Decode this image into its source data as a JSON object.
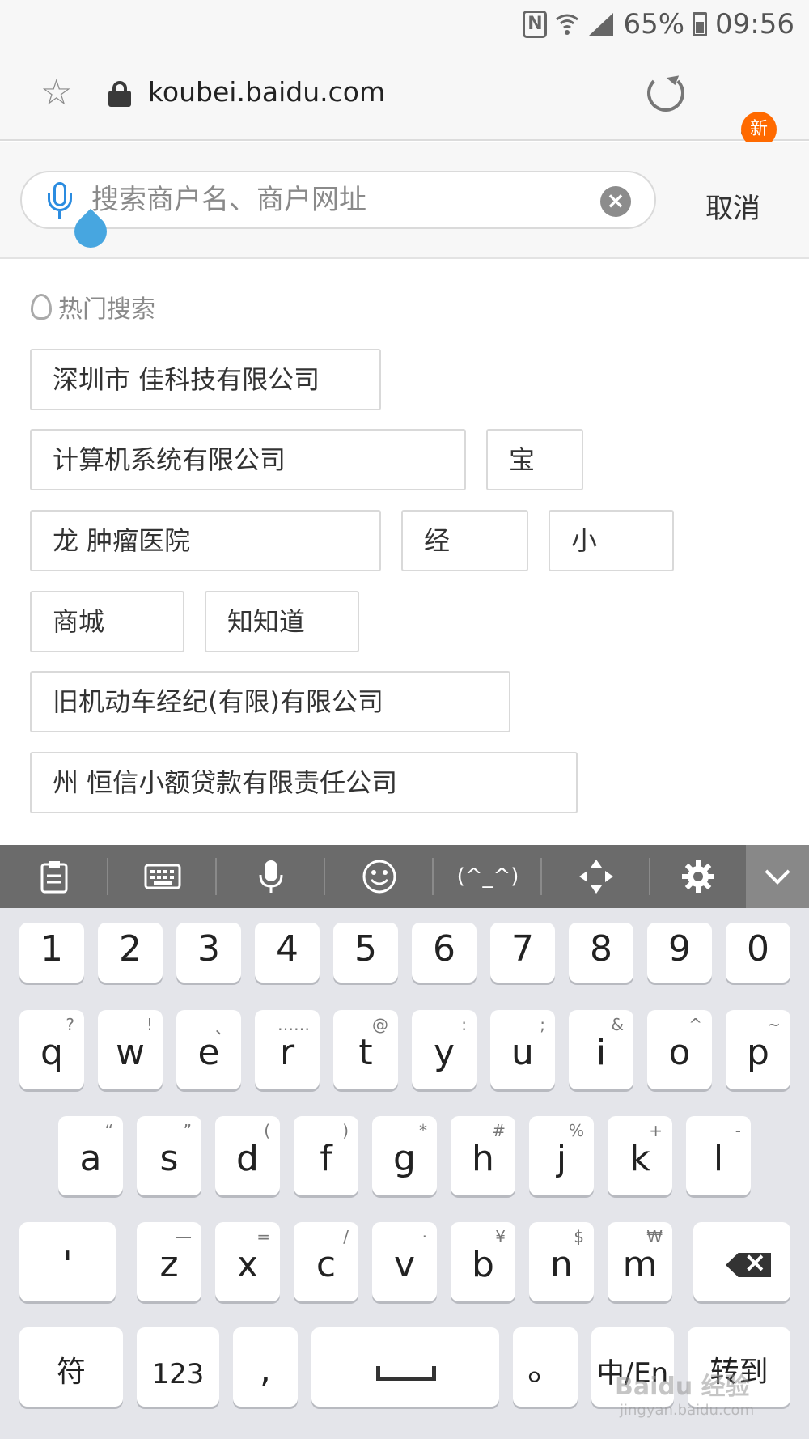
{
  "status_bar": {
    "battery": "65%",
    "time": "09:56",
    "nfc": "N",
    "icons": [
      "nfc-icon",
      "wifi-icon",
      "signal-icon",
      "battery-icon"
    ]
  },
  "browser": {
    "url": "koubei.baidu.com",
    "menu_badge": "新",
    "icons": [
      "star-icon",
      "lock-icon",
      "reload-icon",
      "menu-icon"
    ]
  },
  "search": {
    "placeholder": "搜索商户名、商户网址",
    "cancel_label": "取消",
    "icons": [
      "mic-icon",
      "clear-icon"
    ]
  },
  "hot": {
    "title": "热门搜索",
    "items": [
      "深圳市 佳科技有限公司",
      "计算机系统有限公司",
      "宝",
      "龙 肿瘤医院",
      "经",
      "小",
      "商城",
      "知知道",
      "旧机动车经纪(有限)有限公司",
      "州 恒信小额贷款有限责任公司"
    ]
  },
  "keyboard": {
    "toolbar": [
      "clipboard-icon",
      "keyboard-icon",
      "mic-icon",
      "emoji-icon",
      "(^_^)",
      "move-icon",
      "gear-icon",
      "collapse-icon"
    ],
    "emoticon": "(^_^)",
    "numbers": [
      "1",
      "2",
      "3",
      "4",
      "5",
      "6",
      "7",
      "8",
      "9",
      "0"
    ],
    "row1": [
      "q",
      "w",
      "e",
      "r",
      "t",
      "y",
      "u",
      "i",
      "o",
      "p"
    ],
    "row1_hints": [
      "?",
      "!",
      "、",
      "……",
      "@",
      ":",
      ";",
      "&",
      "^",
      "~"
    ],
    "row2": [
      "a",
      "s",
      "d",
      "f",
      "g",
      "h",
      "j",
      "k",
      "l"
    ],
    "row2_hints": [
      "“",
      "”",
      "(",
      ")",
      "*",
      "#",
      "%",
      "+",
      "-"
    ],
    "row3": [
      "'",
      "z",
      "x",
      "c",
      "v",
      "b",
      "n",
      "m"
    ],
    "row3_hints": [
      "",
      "—",
      "=",
      "/",
      "·",
      "¥",
      "$",
      "₩"
    ],
    "bottom": {
      "symbols": "符",
      "num": "123",
      "comma": ",",
      "period": "。",
      "lang": "中/En",
      "enter": "转到"
    }
  },
  "watermark": {
    "text": "Baidu 经验",
    "url": "jingyan.baidu.com"
  }
}
